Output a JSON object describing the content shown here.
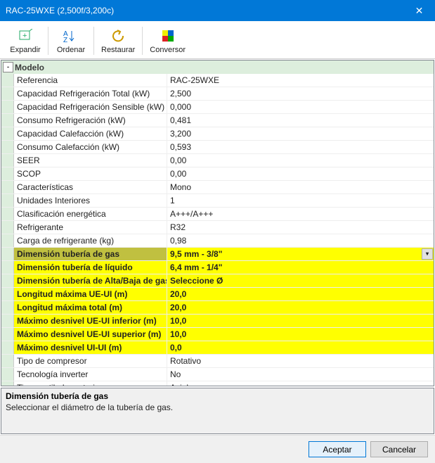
{
  "window": {
    "title": "RAC-25WXE (2,500f/3,200c)",
    "close_glyph": "✕"
  },
  "toolbar": {
    "expand": "Expandir",
    "sort": "Ordenar",
    "restore": "Restaurar",
    "converter": "Conversor"
  },
  "category": {
    "toggle": "-",
    "label": "Modelo"
  },
  "properties": [
    {
      "label": "Referencia",
      "value": "RAC-25WXE",
      "highlight": "none",
      "dropdown": false
    },
    {
      "label": "Capacidad Refrigeración Total (kW)",
      "value": "2,500",
      "highlight": "none",
      "dropdown": false
    },
    {
      "label": "Capacidad Refrigeración Sensible (kW)",
      "value": "0,000",
      "highlight": "none",
      "dropdown": false
    },
    {
      "label": "Consumo Refrigeración (kW)",
      "value": "0,481",
      "highlight": "none",
      "dropdown": false
    },
    {
      "label": "Capacidad Calefacción (kW)",
      "value": "3,200",
      "highlight": "none",
      "dropdown": false
    },
    {
      "label": "Consumo Calefacción (kW)",
      "value": "0,593",
      "highlight": "none",
      "dropdown": false
    },
    {
      "label": "SEER",
      "value": "0,00",
      "highlight": "none",
      "dropdown": false
    },
    {
      "label": "SCOP",
      "value": "0,00",
      "highlight": "none",
      "dropdown": false
    },
    {
      "label": "Características",
      "value": "Mono",
      "highlight": "none",
      "dropdown": false
    },
    {
      "label": "Unidades Interiores",
      "value": "1",
      "highlight": "none",
      "dropdown": false
    },
    {
      "label": "Clasificación energética",
      "value": "A+++/A+++",
      "highlight": "none",
      "dropdown": false
    },
    {
      "label": "Refrigerante",
      "value": "R32",
      "highlight": "none",
      "dropdown": false
    },
    {
      "label": "Carga de refrigerante (kg)",
      "value": "0,98",
      "highlight": "none",
      "dropdown": false
    },
    {
      "label": "Dimensión tubería de gas",
      "value": "9,5 mm - 3/8\"",
      "highlight": "olive",
      "dropdown": true
    },
    {
      "label": "Dimensión tubería de líquido",
      "value": "6,4 mm - 1/4\"",
      "highlight": "yellow",
      "dropdown": false
    },
    {
      "label": "Dimensión tubería de Alta/Baja de gas",
      "value": "Seleccione Ø",
      "highlight": "yellow",
      "dropdown": false
    },
    {
      "label": "Longitud máxima UE-UI (m)",
      "value": "20,0",
      "highlight": "yellow",
      "dropdown": false
    },
    {
      "label": "Longitud máxima total (m)",
      "value": "20,0",
      "highlight": "yellow",
      "dropdown": false
    },
    {
      "label": "Máximo desnivel UE-UI inferior (m)",
      "value": "10,0",
      "highlight": "yellow",
      "dropdown": false
    },
    {
      "label": "Máximo desnivel UE-UI superior (m)",
      "value": "10,0",
      "highlight": "yellow",
      "dropdown": false
    },
    {
      "label": "Máximo desnivel UI-UI (m)",
      "value": "0,0",
      "highlight": "yellow",
      "dropdown": false
    },
    {
      "label": "Tipo de compresor",
      "value": "Rotativo",
      "highlight": "none",
      "dropdown": false
    },
    {
      "label": "Tecnología inverter",
      "value": "No",
      "highlight": "none",
      "dropdown": false
    },
    {
      "label": "Tipo ventilador exterior",
      "value": "Axial",
      "highlight": "none",
      "dropdown": false
    }
  ],
  "help": {
    "title": "Dimensión tubería de gas",
    "text": "Seleccionar el diámetro de la tubería de gas."
  },
  "buttons": {
    "ok": "Aceptar",
    "cancel": "Cancelar"
  }
}
